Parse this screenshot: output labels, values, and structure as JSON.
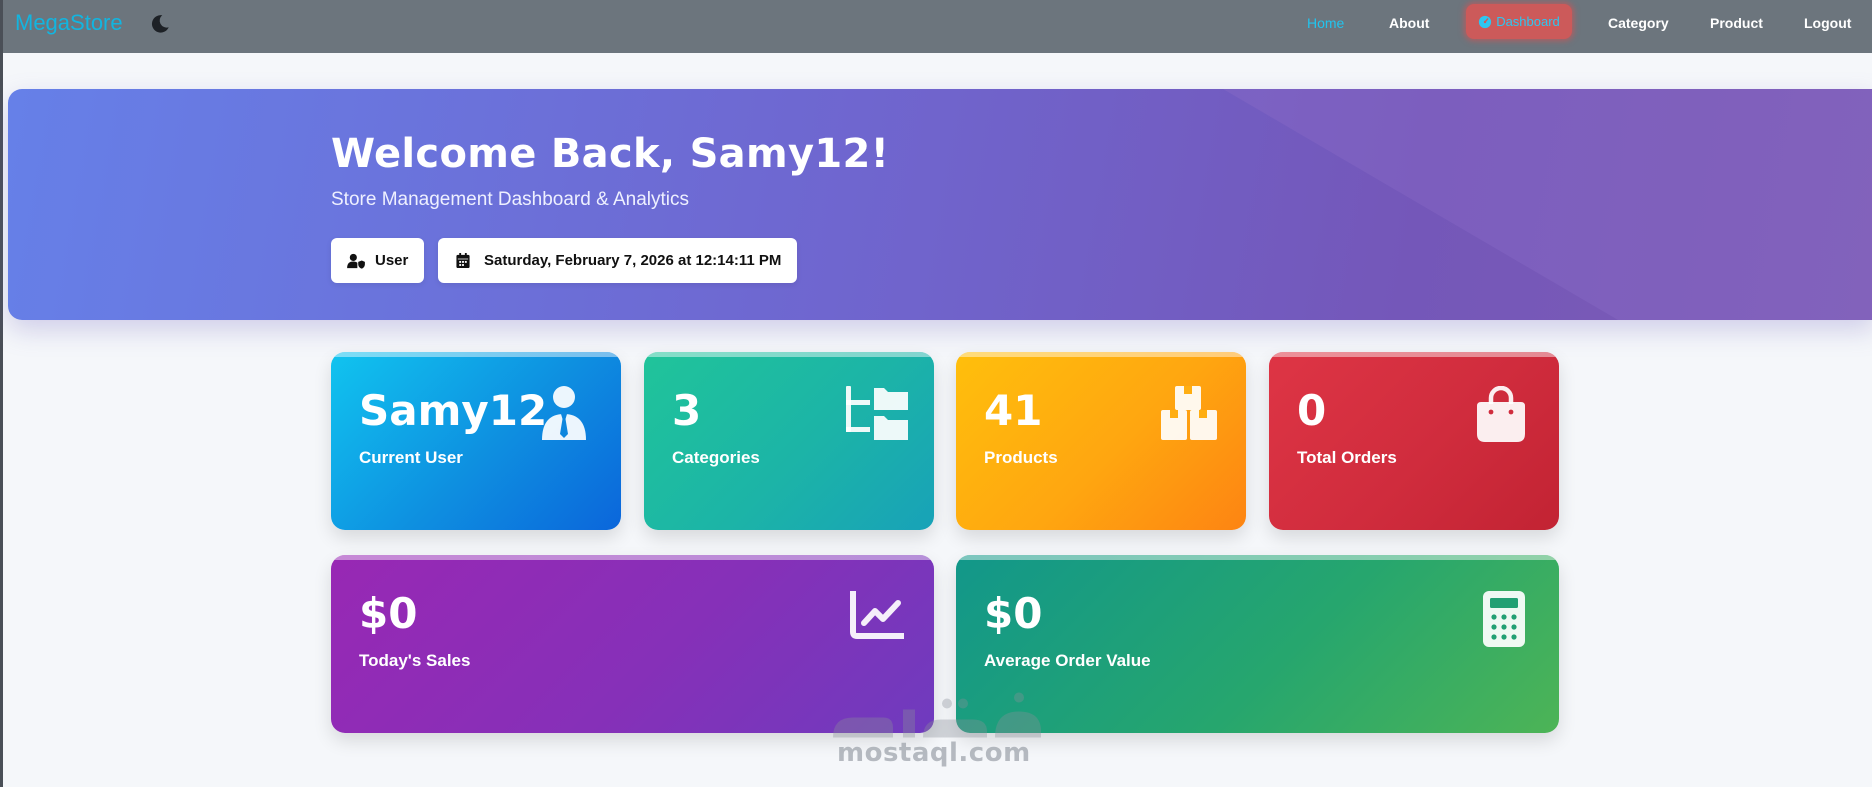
{
  "navbar": {
    "brand": "MegaStore",
    "links": {
      "home": "Home",
      "about": "About",
      "dashboard": "Dashboard",
      "category": "Category",
      "product": "Product",
      "logout": "Logout"
    },
    "colors": {
      "background": "#6c757d",
      "brand": "#12b5e0",
      "active": "#21c4ee"
    }
  },
  "hero": {
    "title": "Welcome Back, Samy12!",
    "subtitle": "Store Management Dashboard & Analytics",
    "role_label": "User",
    "datetime": "Saturday, February 7, 2026 at 12:14:11 PM"
  },
  "stats": [
    {
      "value": "Samy12",
      "label": "Current User",
      "icon": "user-tie-icon"
    },
    {
      "value": "3",
      "label": "Categories",
      "icon": "folder-tree-icon"
    },
    {
      "value": "41",
      "label": "Products",
      "icon": "boxes-icon"
    },
    {
      "value": "0",
      "label": "Total Orders",
      "icon": "shopping-bag-icon"
    },
    {
      "value": "$0",
      "label": "Today's Sales",
      "icon": "chart-line-icon"
    },
    {
      "value": "$0",
      "label": "Average Order Value",
      "icon": "calculator-icon"
    }
  ],
  "watermark": {
    "text": "mostaql.com"
  }
}
